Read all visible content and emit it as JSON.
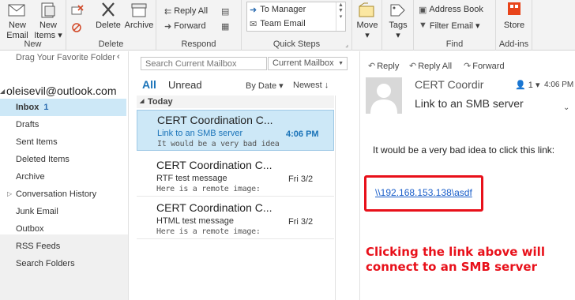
{
  "ribbon": {
    "new_group": {
      "label": "New",
      "new_email": "New Email",
      "new_items": "New Items ▾"
    },
    "delete_group": {
      "label": "Delete",
      "delete": "Delete",
      "archive": "Archive"
    },
    "respond_group": {
      "label": "Respond",
      "reply_all": "Reply All",
      "forward": "Forward"
    },
    "quick_steps": {
      "label": "Quick Steps",
      "items": [
        "To Manager",
        "Team Email"
      ]
    },
    "move": {
      "label": "Move",
      "caret": "▾"
    },
    "tags": {
      "label": "Tags",
      "caret": "▾"
    },
    "find_group": {
      "label": "Find",
      "address_book": "Address Book",
      "filter_email": "Filter Email ▾"
    },
    "addins_group": {
      "label": "Add-ins",
      "store": "Store"
    },
    "store_color": "#e8441a"
  },
  "folders": {
    "hint": "Drag Your Favorite Folder",
    "collapse_glyph": "‹",
    "account": "oleisevil@outlook.com",
    "items": [
      {
        "label": "Inbox",
        "count": "1",
        "selected": true
      },
      {
        "label": "Drafts"
      },
      {
        "label": "Sent Items"
      },
      {
        "label": "Deleted Items"
      },
      {
        "label": "Archive"
      },
      {
        "label": "Conversation History",
        "expandable": true
      },
      {
        "label": "Junk Email"
      },
      {
        "label": "Outbox"
      },
      {
        "label": "RSS Feeds"
      },
      {
        "label": "Search Folders"
      }
    ]
  },
  "list": {
    "search_placeholder": "Search Current Mailbox",
    "scope": "Current Mailbox",
    "tab_all": "All",
    "tab_unread": "Unread",
    "sort_by": "By Date ▾",
    "sort_dir": "Newest ↓",
    "group_today": "Today",
    "messages": [
      {
        "from": "CERT Coordination C...",
        "subject": "Link to an SMB server",
        "preview": "It would be a very bad idea",
        "time": "4:06 PM",
        "selected": true
      },
      {
        "from": "CERT Coordination C...",
        "subject": "RTF test message",
        "preview": "Here is a remote image:",
        "time": "Fri 3/2"
      },
      {
        "from": "CERT Coordination C...",
        "subject": "HTML test message",
        "preview": "Here is a remote image:",
        "time": "Fri 3/2"
      }
    ]
  },
  "reader": {
    "reply": "Reply",
    "reply_all": "Reply All",
    "forward": "Forward",
    "sender": "CERT Coordir",
    "people_count": "1",
    "time": "4:06 PM",
    "subject": "Link to an SMB server",
    "body": "It would be a very bad idea to click this link:",
    "link": "\\\\192.168.153.138\\asdf",
    "annotation": "Clicking the link above will connect to an SMB server",
    "annotation_color": "#e8101a"
  }
}
